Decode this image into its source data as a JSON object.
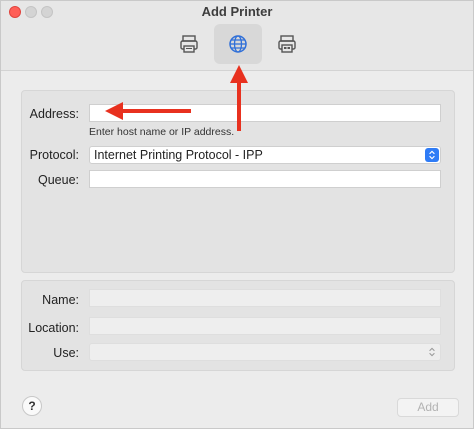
{
  "window": {
    "title": "Add Printer"
  },
  "toolbar": {
    "buttons": [
      {
        "icon": "printer-icon"
      },
      {
        "icon": "globe-icon",
        "selected": true
      },
      {
        "icon": "windows-printer-icon"
      }
    ]
  },
  "form": {
    "address_label": "Address:",
    "address_value": "",
    "address_hint": "Enter host name or IP address.",
    "protocol_label": "Protocol:",
    "protocol_value": "Internet Printing Protocol - IPP",
    "queue_label": "Queue:",
    "queue_value": ""
  },
  "details": {
    "name_label": "Name:",
    "name_value": "",
    "location_label": "Location:",
    "location_value": "",
    "use_label": "Use:",
    "use_value": ""
  },
  "footer": {
    "help_label": "?",
    "add_label": "Add"
  },
  "colors": {
    "accent": "#2f7cf6",
    "annotation_arrow": "#e8311f"
  }
}
